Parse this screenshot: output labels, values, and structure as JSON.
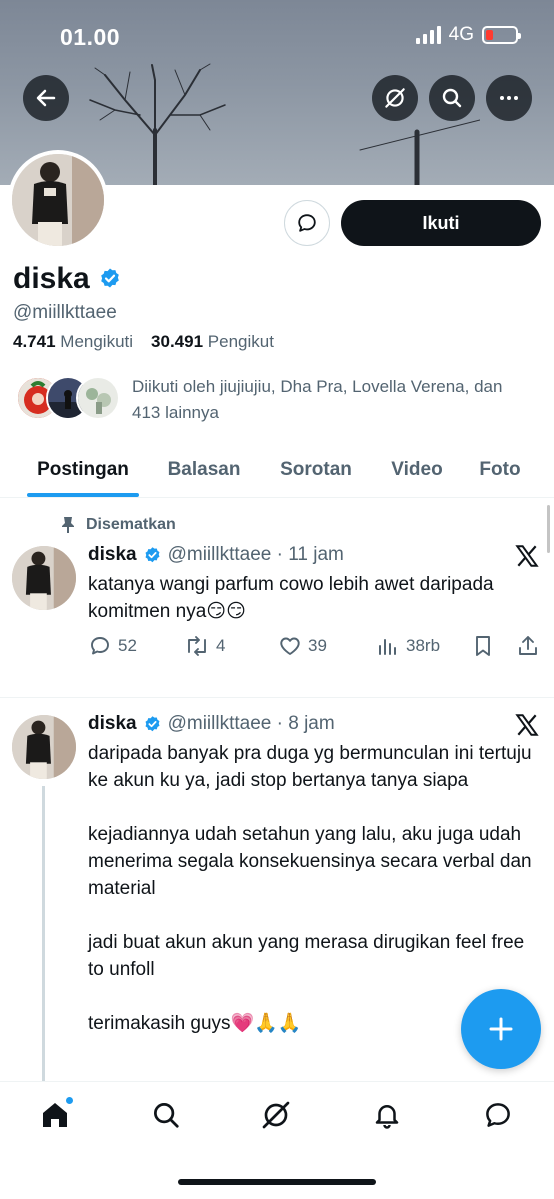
{
  "status": {
    "time": "01.00",
    "network": "4G"
  },
  "profile": {
    "display_name": "diska",
    "handle": "@miillkttaee",
    "following_count": "4.741",
    "following_label": "Mengikuti",
    "followers_count": "30.491",
    "followers_label": "Pengikut",
    "followed_by_text": "Diikuti oleh jiujiujiu, Dha Pra, Lovella Verena, dan 413 lainnya",
    "follow_label": "Ikuti"
  },
  "tabs": [
    {
      "label": "Postingan",
      "active": true
    },
    {
      "label": "Balasan"
    },
    {
      "label": "Sorotan"
    },
    {
      "label": "Video"
    },
    {
      "label": "Foto"
    }
  ],
  "posts": [
    {
      "pinned_label": "Disematkan",
      "name": "diska",
      "handle_time": "@miillkttaee · 11 jam",
      "text": "katanya wangi parfum cowo lebih awet daripada komitmen nya😏😏",
      "replies": "52",
      "reposts": "4",
      "likes": "39",
      "views": "38rb"
    },
    {
      "name": "diska",
      "handle_time": "@miillkttaee · 8 jam",
      "text": "daripada banyak pra duga yg bermunculan ini tertuju ke akun ku ya, jadi stop bertanya tanya siapa\n\nkejadiannya udah setahun yang lalu, aku juga udah menerima segala konsekuensinya secara verbal dan material\n\njadi buat akun akun yang merasa dirugikan feel free to unfoll\n\nterimakasih guys💗🙏🙏"
    }
  ],
  "colors": {
    "accent": "#1d9bf0",
    "text": "#0f1419",
    "muted": "#536471"
  }
}
